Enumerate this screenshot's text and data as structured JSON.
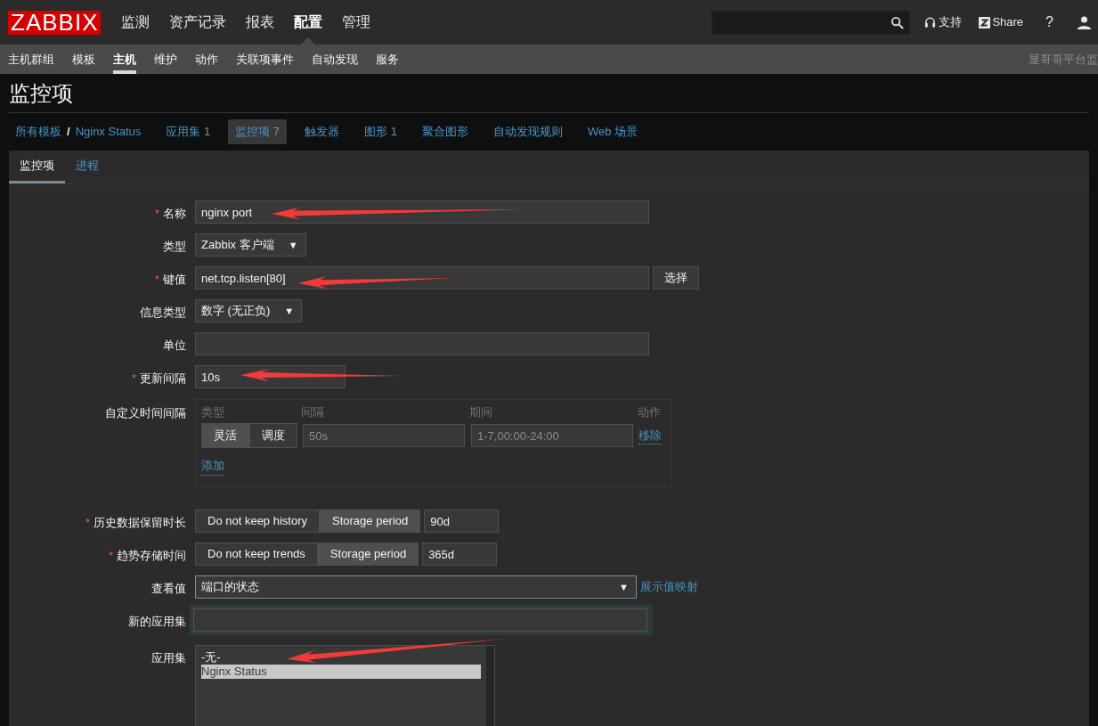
{
  "header": {
    "logo": "ZABBIX",
    "menu": [
      {
        "label": "监测",
        "selected": false
      },
      {
        "label": "资产记录",
        "selected": false
      },
      {
        "label": "报表",
        "selected": false
      },
      {
        "label": "配置",
        "selected": true
      },
      {
        "label": "管理",
        "selected": false
      }
    ],
    "support": "支持",
    "share": "Share",
    "help": "?"
  },
  "submenu": {
    "items": [
      {
        "label": "主机群组",
        "selected": false
      },
      {
        "label": "模板",
        "selected": false
      },
      {
        "label": "主机",
        "selected": true
      },
      {
        "label": "维护",
        "selected": false
      },
      {
        "label": "动作",
        "selected": false
      },
      {
        "label": "关联项事件",
        "selected": false
      },
      {
        "label": "自动发现",
        "selected": false
      },
      {
        "label": "服务",
        "selected": false
      }
    ],
    "server_name": "显哥哥平台监"
  },
  "page_title": "监控项",
  "breadcrumbs": {
    "root": "所有模板",
    "separator": "/",
    "host": "Nginx Status",
    "items": [
      {
        "label": "应用集",
        "count": "1",
        "selected": false
      },
      {
        "label": "监控项",
        "count": "7",
        "selected": true
      },
      {
        "label": "触发器",
        "selected": false
      },
      {
        "label": "图形",
        "count": "1",
        "selected": false
      },
      {
        "label": "聚合图形",
        "selected": false
      },
      {
        "label": "自动发现规则",
        "selected": false
      },
      {
        "label": "Web 场景",
        "selected": false
      }
    ]
  },
  "tabs": [
    {
      "label": "监控项",
      "selected": true
    },
    {
      "label": "进程",
      "selected": false
    }
  ],
  "form": [
    {
      "kind": "text",
      "label": "名称",
      "required_mark": "*",
      "value": "nginx port"
    },
    {
      "kind": "select",
      "label": "类型",
      "value": "Zabbix 客户端",
      "arrow": "▼"
    },
    {
      "kind": "text_button",
      "label": "键值",
      "required_mark": "*",
      "value": "net.tcp.listen[80]",
      "button": "选择"
    },
    {
      "kind": "select",
      "label": "信息类型",
      "value": "数字 (无正负)",
      "arrow": "▼"
    },
    {
      "kind": "text",
      "label": "单位"
    },
    {
      "kind": "short_text",
      "label": "更新间隔",
      "required_mark": "*",
      "value": "10s"
    },
    {
      "kind": "interval",
      "label": "自定义时间间隔",
      "columns": [
        "类型",
        "间隔",
        "期间",
        "动作"
      ],
      "options": [
        {
          "label": "灵活",
          "selected": true
        },
        {
          "label": "调度",
          "selected": false
        }
      ],
      "interval_placeholder": "50s",
      "period_placeholder": "1-7,00:00-24:00",
      "remove": "移除",
      "add": "添加"
    },
    {
      "kind": "segmented",
      "label": "历史数据保留时长",
      "required_mark": "*",
      "options": [
        {
          "label": "Do not keep history",
          "selected": false
        },
        {
          "label": "Storage period",
          "selected": true
        }
      ],
      "value": "90d"
    },
    {
      "kind": "segmented",
      "label": "趋势存储时间",
      "required_mark": "*",
      "options": [
        {
          "label": "Do not keep trends",
          "selected": false
        },
        {
          "label": "Storage period",
          "selected": true
        }
      ],
      "value": "365d"
    },
    {
      "kind": "select_link",
      "label": "查看值",
      "value": "端口的状态",
      "arrow": "▼",
      "link": "展示值映射"
    },
    {
      "kind": "focused_text",
      "label": "新的应用集"
    },
    {
      "kind": "listbox",
      "label": "应用集",
      "options": [
        {
          "label": "-无-",
          "selected": false
        },
        {
          "label": "Nginx Status",
          "selected": true
        }
      ]
    }
  ]
}
